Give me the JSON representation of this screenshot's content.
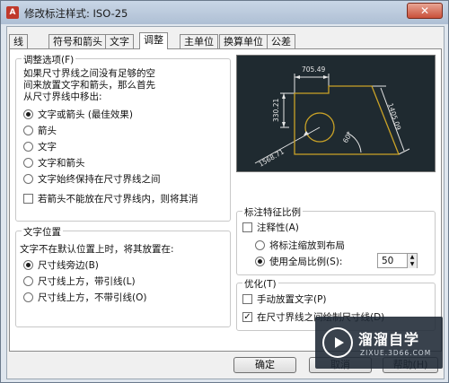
{
  "window": {
    "title": "修改标注样式: ISO-25",
    "icon_name": "autocad-icon",
    "close_label": "✕"
  },
  "tabs": [
    {
      "label": "线"
    },
    {
      "label": "符号和箭头"
    },
    {
      "label": "文字"
    },
    {
      "label": "调整",
      "active": true
    },
    {
      "label": "主单位"
    },
    {
      "label": "换算单位"
    },
    {
      "label": "公差"
    }
  ],
  "fit_options": {
    "title": "调整选项(F)",
    "description": [
      "如果尺寸界线之间没有足够的空",
      "间来放置文字和箭头，那么首先",
      "从尺寸界线中移出:"
    ],
    "radios": [
      {
        "label": "文字或箭头 (最佳效果)",
        "selected": true
      },
      {
        "label": "箭头",
        "selected": false
      },
      {
        "label": "文字",
        "selected": false
      },
      {
        "label": "文字和箭头",
        "selected": false
      },
      {
        "label": "文字始终保持在尺寸界线之间",
        "selected": false
      }
    ],
    "checkbox": {
      "label": "若箭头不能放在尺寸界线内，则将其消",
      "checked": false
    }
  },
  "text_placement": {
    "title": "文字位置",
    "description": "文字不在默认位置上时，将其放置在:",
    "radios": [
      {
        "label": "尺寸线旁边(B)",
        "selected": true
      },
      {
        "label": "尺寸线上方，带引线(L)",
        "selected": false
      },
      {
        "label": "尺寸线上方，不带引线(O)",
        "selected": false
      }
    ]
  },
  "preview": {
    "dims": [
      "705.49",
      "330.21",
      "1405.09",
      "60°",
      "1568.71"
    ],
    "bg_color": "#1f2a30",
    "line_color": "#e6e6e6",
    "shape_color": "#c9a227"
  },
  "scale": {
    "title": "标注特征比例",
    "annotative": {
      "label": "注释性(A)",
      "checked": false
    },
    "radios": [
      {
        "label": "将标注缩放到布局",
        "selected": false
      },
      {
        "label": "使用全局比例(S):",
        "selected": true
      }
    ],
    "value": "50"
  },
  "fine_tuning": {
    "title": "优化(T)",
    "checks": [
      {
        "label": "手动放置文字(P)",
        "checked": false
      },
      {
        "label": "在尺寸界线之间绘制尺寸线(D)",
        "checked": true
      }
    ]
  },
  "buttons": {
    "ok": "确定",
    "cancel": "取消",
    "help": "帮助(H)"
  },
  "watermark": {
    "title": "溜溜自学",
    "subtitle": "ZIXUE.3D66.COM"
  }
}
